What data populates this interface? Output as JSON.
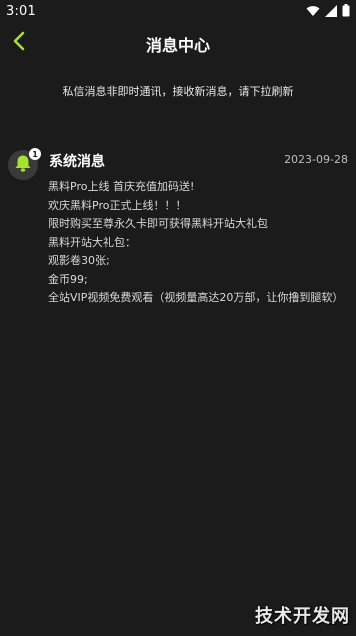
{
  "status_bar": {
    "time": "3:01"
  },
  "header": {
    "title": "消息中心"
  },
  "notice": "私信消息非即时通讯，接收新消息，请下拉刷新",
  "message": {
    "title": "系统消息",
    "date": "2023-09-28",
    "badge_count": "1",
    "lines": [
      "黑料Pro上线 首庆充值加码送!",
      "欢庆黑料Pro正式上线！！！",
      "限时购买至尊永久卡即可获得黑料开站大礼包",
      "黑料开站大礼包：",
      "观影卷30张;",
      "金币99;",
      "全站VIP视频免费观看（视频量高达20万部，让你撸到腿软）"
    ]
  },
  "watermark": "技术开发网",
  "colors": {
    "accent": "#a6e22e",
    "background": "#1b1b1b"
  }
}
